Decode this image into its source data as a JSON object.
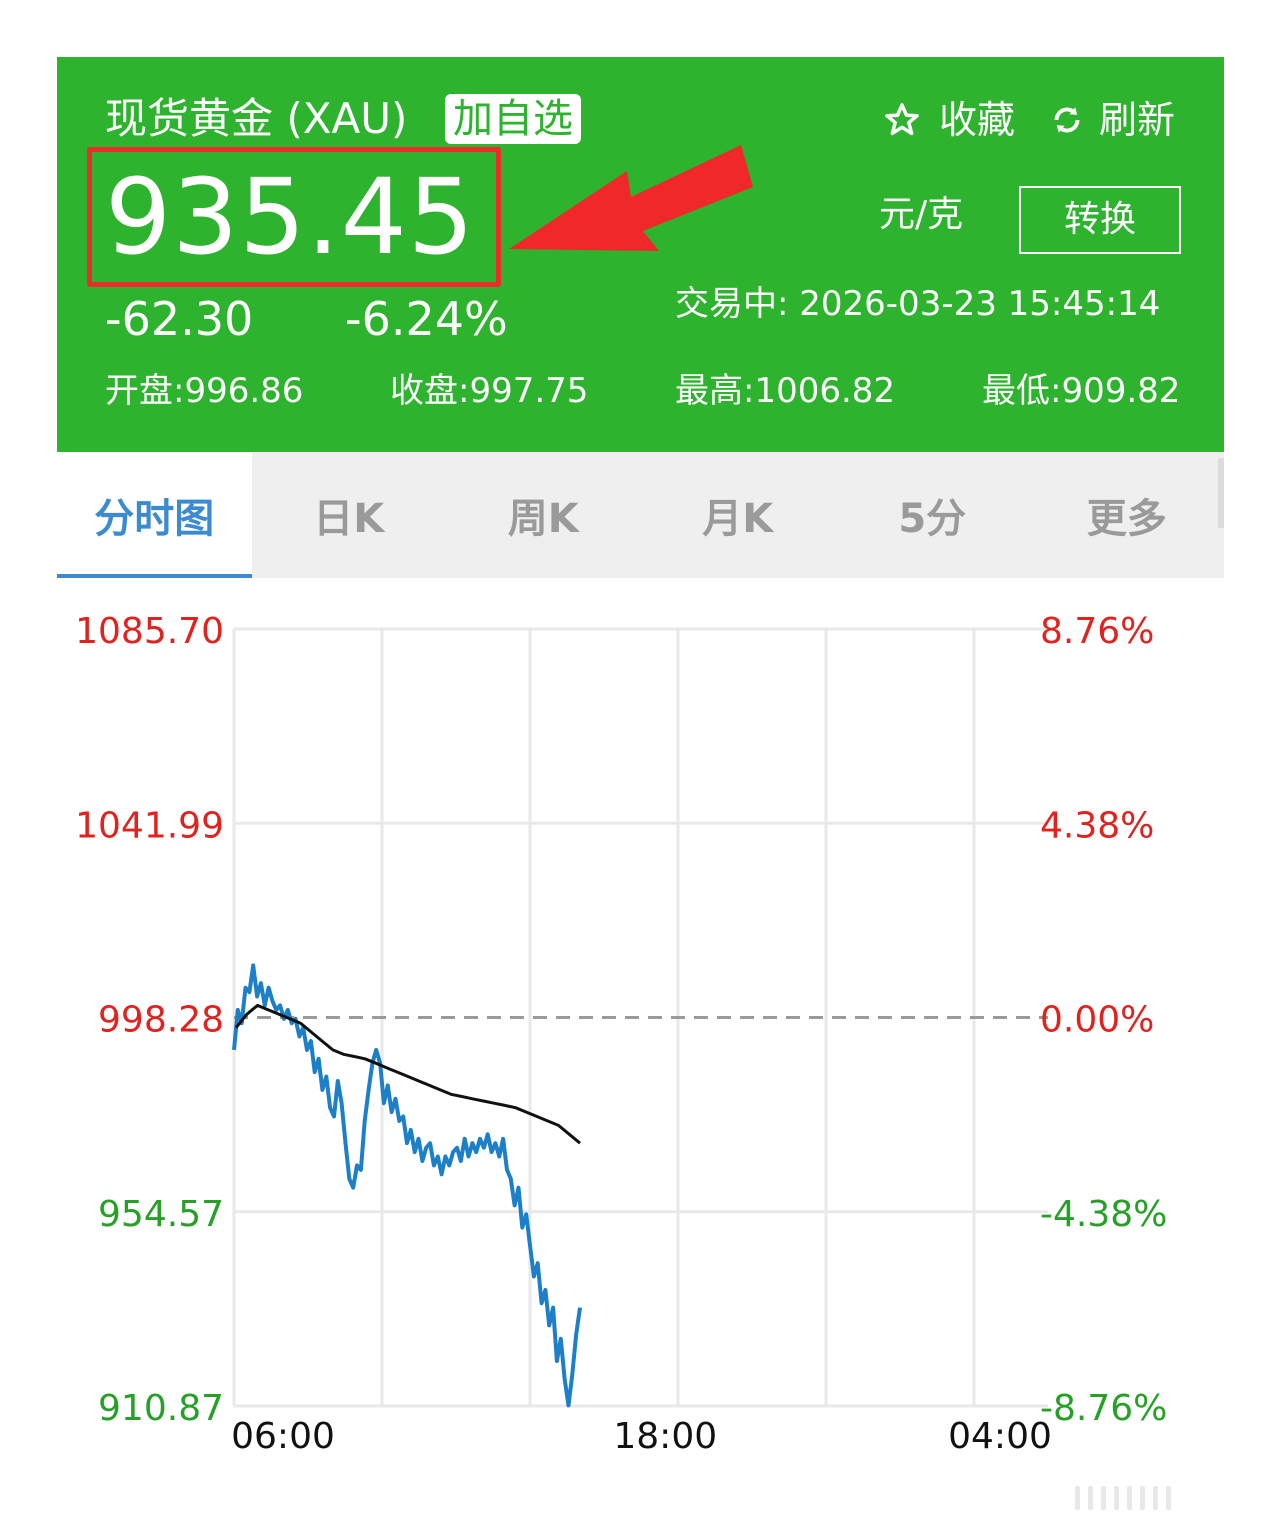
{
  "header": {
    "title": "现货黄金 (XAU)",
    "watch_tag": "加自选",
    "favorite_label": "收藏",
    "refresh_label": "刷新",
    "price": "935.45",
    "unit": "元/克",
    "convert_label": "转换",
    "change_abs": "-62.30",
    "change_pct": "-6.24%",
    "status": "交易中:  2026-03-23 15:45:14",
    "open": "开盘:996.86",
    "close": "收盘:997.75",
    "high": "最高:1006.82",
    "low": "最低:909.82",
    "bg_color": "#2db32d",
    "highlight_color": "#ee2b2b"
  },
  "tabs": [
    {
      "label": "分时图",
      "active": true
    },
    {
      "label": "日K",
      "active": false
    },
    {
      "label": "周K",
      "active": false
    },
    {
      "label": "月K",
      "active": false
    },
    {
      "label": "5分",
      "active": false
    },
    {
      "label": "更多",
      "active": false
    }
  ],
  "chart_data": {
    "type": "line",
    "baseline": 998.28,
    "y_ticks": [
      "1085.70",
      "1041.99",
      "998.28",
      "954.57",
      "910.87"
    ],
    "y_pct_ticks": [
      "8.76%",
      "4.38%",
      "0.00%",
      "-4.38%",
      "-8.76%"
    ],
    "x_ticks": [
      "06:00",
      "18:00",
      "04:00"
    ],
    "ylim": [
      910.87,
      1085.7
    ],
    "up_color": "#e0231f",
    "down_color": "#27a027",
    "series": [
      {
        "color": "#1e7fc9",
        "values": [
          991,
          1000,
          997,
          1005,
          1004,
          1010,
          1003,
          1006,
          1001,
          1005,
          1002,
          1000,
          1001,
          998,
          1000,
          997,
          998,
          994,
          996,
          991,
          993,
          986,
          989,
          982,
          985,
          978,
          976,
          984,
          979,
          970,
          962,
          960,
          965,
          964,
          975,
          982,
          988,
          991,
          988,
          979,
          983,
          977,
          980,
          975,
          976,
          970,
          973,
          968,
          971,
          966,
          969,
          970,
          965,
          967,
          963,
          967,
          965,
          968,
          969,
          966,
          971,
          967,
          970,
          968,
          971,
          969,
          972,
          968,
          970,
          967,
          971,
          964,
          962,
          956,
          960,
          951,
          954,
          947,
          940,
          943,
          934,
          937,
          929,
          933,
          921,
          926,
          917,
          911,
          918,
          927,
          933
        ]
      },
      {
        "color": "#111111",
        "values": [
          996,
          999,
          1001,
          1000,
          999,
          998,
          997,
          995,
          993,
          991,
          990,
          989.5,
          989,
          988,
          987,
          986,
          985,
          984,
          983,
          982,
          981,
          980.5,
          980,
          979.5,
          979,
          978.5,
          978,
          977,
          976,
          975,
          974,
          972,
          970
        ]
      }
    ]
  }
}
